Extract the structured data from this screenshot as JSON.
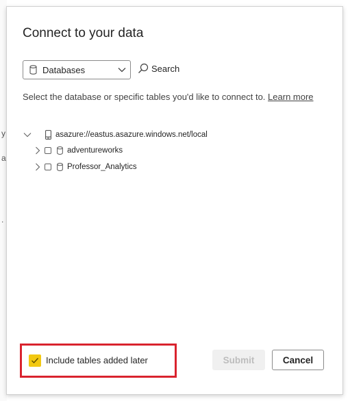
{
  "background": {
    "marks": [
      "y",
      "a",
      "."
    ]
  },
  "dialog": {
    "title": "Connect to your data",
    "source_select": {
      "value": "Databases",
      "icon": "database-icon"
    },
    "search": {
      "label": "Search",
      "icon": "search-icon"
    },
    "instructions": "Select the database or specific tables you'd like to connect to.",
    "learn_more": "Learn more"
  },
  "tree": {
    "server": {
      "label": "asazure://eastus.asazure.windows.net/local",
      "icon": "server-icon",
      "expanded": true
    },
    "databases": [
      {
        "label": "adventureworks",
        "checked": false,
        "icon": "database-icon"
      },
      {
        "label": "Professor_Analytics",
        "checked": false,
        "icon": "database-icon"
      }
    ]
  },
  "footer": {
    "include_later_label": "Include tables added later",
    "include_later_checked": true,
    "submit_label": "Submit",
    "cancel_label": "Cancel"
  },
  "colors": {
    "accent_checkbox": "#f2c811",
    "highlight_border": "#d9232e",
    "disabled_button_bg": "#f0f0f0",
    "disabled_button_text": "#bdbdbd"
  }
}
